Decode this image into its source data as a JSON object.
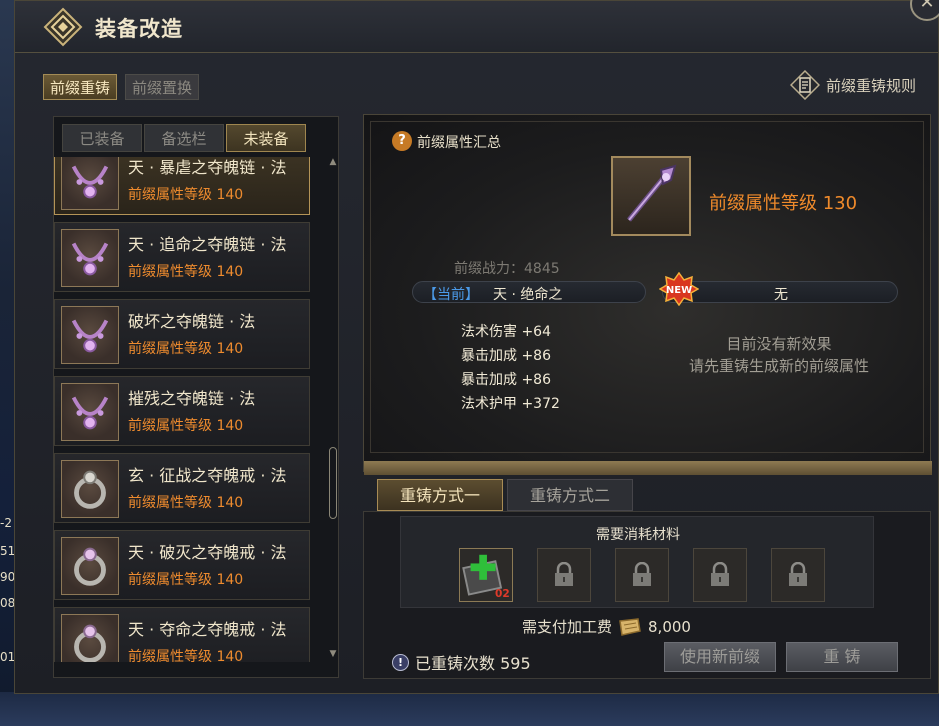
{
  "window": {
    "title": "装备改造"
  },
  "top_tabs": [
    "前缀重铸",
    "前缀置换"
  ],
  "rules_link": "前缀重铸规则",
  "sub_tabs": [
    "已装备",
    "备选栏",
    "未装备"
  ],
  "items": [
    {
      "name": "天 · 暴虐之夺魄链 · 法",
      "level": "前缀属性等级 140",
      "type": "necklace"
    },
    {
      "name": "天 · 追命之夺魄链 · 法",
      "level": "前缀属性等级 140",
      "type": "necklace"
    },
    {
      "name": "破坏之夺魄链 · 法",
      "level": "前缀属性等级 140",
      "type": "necklace"
    },
    {
      "name": "摧残之夺魄链 · 法",
      "level": "前缀属性等级 140",
      "type": "necklace"
    },
    {
      "name": "玄 · 征战之夺魄戒 · 法",
      "level": "前缀属性等级 140",
      "type": "ring"
    },
    {
      "name": "天 · 破灭之夺魄戒 · 法",
      "level": "前缀属性等级 140",
      "type": "ring"
    },
    {
      "name": "天 · 夺命之夺魄戒 · 法",
      "level": "前缀属性等级 140",
      "type": "ring"
    }
  ],
  "summary": {
    "title": "前缀属性汇总",
    "prefix_level": "前缀属性等级 130",
    "power": "前缀战力：4845",
    "current_tag": "【当前】",
    "current_name": "天 · 绝命之",
    "new_badge": "NEW",
    "new_value": "无",
    "stats": [
      "法术伤害 +64",
      "暴击加成 +86",
      "暴击加成 +86",
      "法术护甲 +372"
    ],
    "no_effect_line1": "目前没有新效果",
    "no_effect_line2": "请先重铸生成新的前缀属性"
  },
  "methods": [
    "重铸方式一",
    "重铸方式二"
  ],
  "materials": {
    "title": "需要消耗材料",
    "first_count": "02",
    "locked_slots": 4
  },
  "fee": {
    "label": "需支付加工费",
    "amount": "8,000"
  },
  "reforge_count": "已重铸次数 595",
  "buttons": {
    "use_new": "使用新前缀",
    "reforge": "重 铸"
  },
  "side_numbers": [
    "-2",
    "51",
    "90",
    "08",
    "01"
  ],
  "colors": {
    "accent_orange": "#ef8a2b",
    "current_blue": "#4b9ae8",
    "gold_border": "#a88c55"
  }
}
